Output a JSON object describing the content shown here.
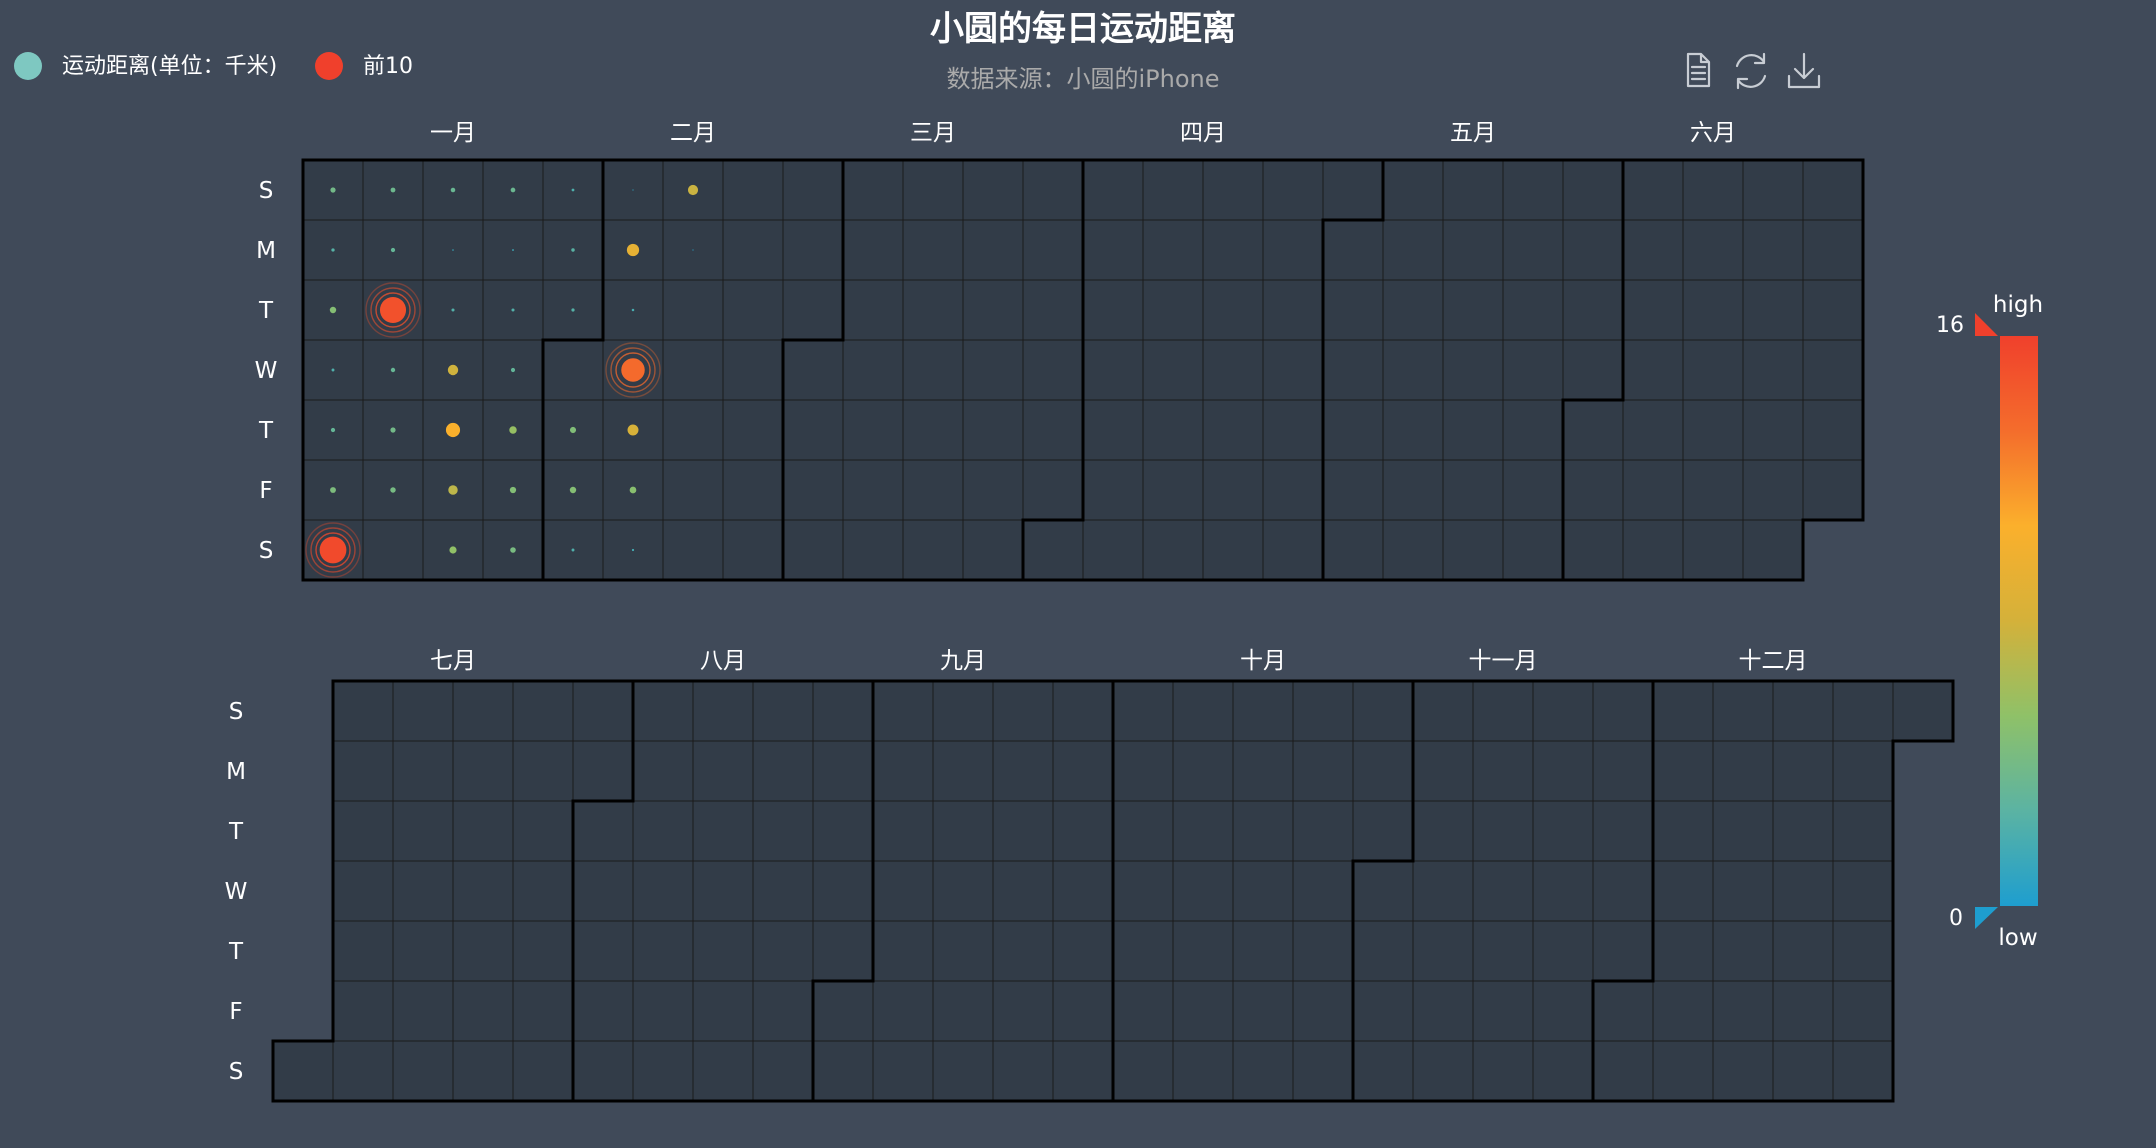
{
  "title": "小圆的每日运动距离",
  "subtitle": "数据来源：小圆的iPhone",
  "legend": [
    {
      "label": "运动距离(单位：千米)",
      "color": "#7ec8c1"
    },
    {
      "label": "前10",
      "color": "#f0402c"
    }
  ],
  "toolbox": [
    "data-view-icon",
    "restore-icon",
    "save-image-icon"
  ],
  "visual_map": {
    "min": 0,
    "max": 16,
    "min_label": "0",
    "max_label": "16",
    "text_high": "high",
    "text_low": "low",
    "colors": [
      "#1e9ecf",
      "#5bb3a3",
      "#8fc168",
      "#d4b13a",
      "#fbb02c",
      "#f46d2c",
      "#f0402c"
    ]
  },
  "chart_data": {
    "type": "calendar-scatter",
    "year": 2017,
    "day_labels": [
      "S",
      "M",
      "T",
      "W",
      "T",
      "F",
      "S"
    ],
    "calendars": [
      {
        "range": "2017-01-01 ~ 2017-06-30",
        "months": [
          "一月",
          "二月",
          "三月",
          "四月",
          "五月",
          "六月"
        ]
      },
      {
        "range": "2017-07-01 ~ 2017-12-31",
        "months": [
          "七月",
          "八月",
          "九月",
          "十月",
          "十一月",
          "十二月"
        ]
      }
    ],
    "series": [
      {
        "name": "运动距离(单位：千米)",
        "type": "scatter",
        "data": [
          [
            "2017-01-01",
            3.9
          ],
          [
            "2017-01-02",
            2.5
          ],
          [
            "2017-01-03",
            4.8
          ],
          [
            "2017-01-04",
            2.2
          ],
          [
            "2017-01-05",
            3.2
          ],
          [
            "2017-01-06",
            4.4
          ],
          [
            "2017-01-07",
            2.6
          ],
          [
            "2017-01-08",
            3.6
          ],
          [
            "2017-01-09",
            3.2
          ],
          [
            "2017-01-11",
            3.3
          ],
          [
            "2017-01-12",
            3.9
          ],
          [
            "2017-01-13",
            4.1
          ],
          [
            "2017-01-15",
            3.4
          ],
          [
            "2017-01-16",
            1.2
          ],
          [
            "2017-01-17",
            2.3
          ],
          [
            "2017-01-18",
            7.8
          ],
          [
            "2017-01-19",
            10.6
          ],
          [
            "2017-01-20",
            7.1
          ],
          [
            "2017-01-21",
            5.4
          ],
          [
            "2017-01-22",
            3.5
          ],
          [
            "2017-01-23",
            1.4
          ],
          [
            "2017-01-24",
            2.3
          ],
          [
            "2017-01-25",
            3.1
          ],
          [
            "2017-01-26",
            5.6
          ],
          [
            "2017-01-27",
            4.7
          ],
          [
            "2017-01-28",
            4.2
          ],
          [
            "2017-01-29",
            2.1
          ],
          [
            "2017-01-30",
            2.6
          ],
          [
            "2017-01-31",
            2.4
          ],
          [
            "2017-02-02",
            4.6
          ],
          [
            "2017-02-03",
            4.8
          ],
          [
            "2017-02-04",
            2.2
          ],
          [
            "2017-02-05",
            0.8
          ],
          [
            "2017-02-06",
            9.2
          ],
          [
            "2017-02-07",
            1.9
          ],
          [
            "2017-02-09",
            8.2
          ],
          [
            "2017-02-10",
            5.0
          ],
          [
            "2017-02-11",
            1.7
          ],
          [
            "2017-02-12",
            7.6
          ],
          [
            "2017-02-13",
            0.5
          ]
        ]
      },
      {
        "name": "前10",
        "type": "effectScatter",
        "data": [
          [
            "2017-01-07",
            15.4
          ],
          [
            "2017-01-10",
            15.0
          ],
          [
            "2017-02-08",
            13.5
          ]
        ]
      }
    ]
  }
}
